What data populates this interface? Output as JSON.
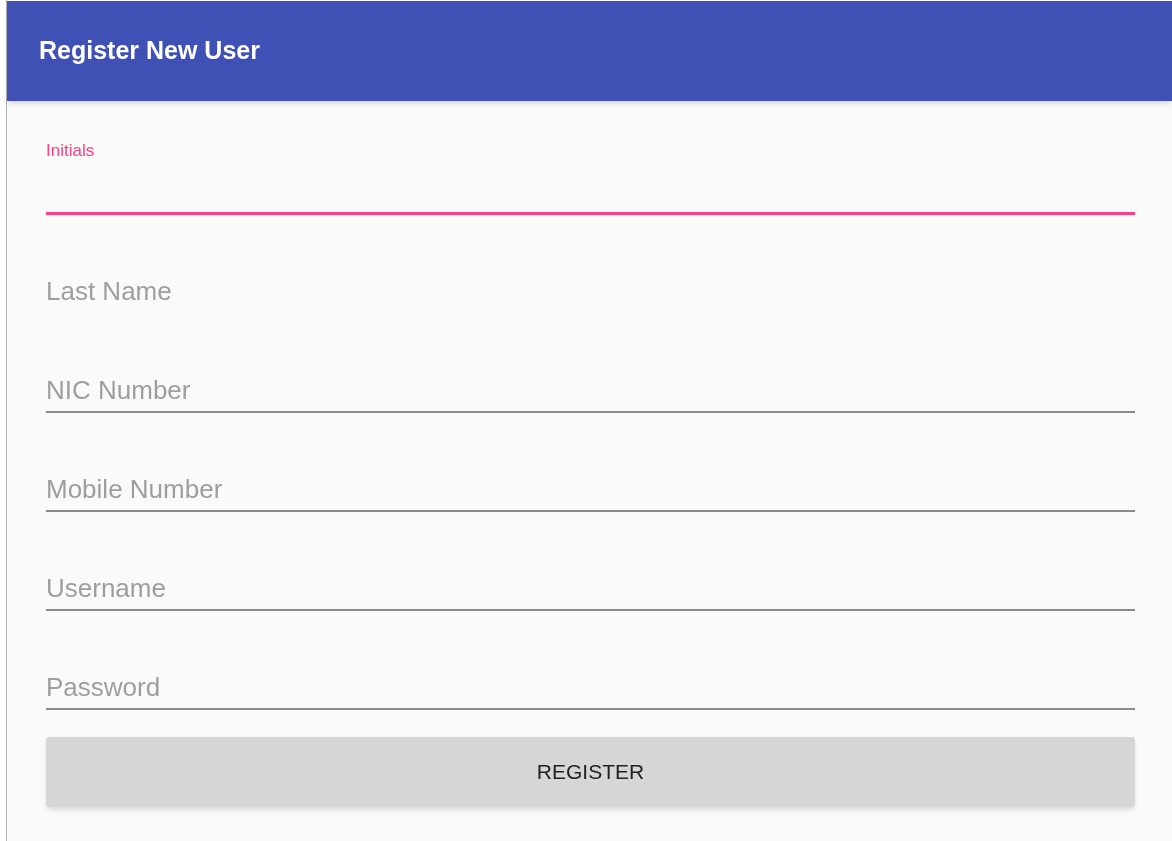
{
  "app_bar": {
    "title": "Register New User"
  },
  "fields": [
    {
      "label": "Initials",
      "focused": true,
      "underlined": true
    },
    {
      "placeholder": "Last Name",
      "focused": false,
      "underlined": false
    },
    {
      "placeholder": "NIC Number",
      "focused": false,
      "underlined": true
    },
    {
      "placeholder": "Mobile Number",
      "focused": false,
      "underlined": true
    },
    {
      "placeholder": "Username",
      "focused": false,
      "underlined": true
    },
    {
      "placeholder": "Password",
      "focused": false,
      "underlined": true
    }
  ],
  "button": {
    "label": "REGISTER"
  }
}
